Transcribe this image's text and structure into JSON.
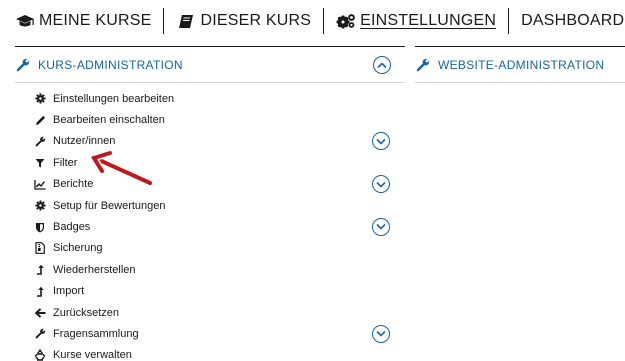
{
  "topnav": {
    "items": [
      {
        "label": "MEINE KURSE",
        "icon": "graduation-cap-icon"
      },
      {
        "label": "DIESER KURS",
        "icon": "book-icon"
      },
      {
        "label": "EINSTELLUNGEN",
        "icon": "cogs-icon",
        "active": true
      },
      {
        "label": "DASHBOARD"
      }
    ]
  },
  "course_admin": {
    "title": "KURS-ADMINISTRATION",
    "items": [
      {
        "label": "Einstellungen bearbeiten",
        "icon": "gear-icon"
      },
      {
        "label": "Bearbeiten einschalten",
        "icon": "pencil-icon"
      },
      {
        "label": "Nutzer/innen",
        "icon": "wrench-icon",
        "expandable": true
      },
      {
        "label": "Filter",
        "icon": "filter-icon"
      },
      {
        "label": "Berichte",
        "icon": "line-chart-icon",
        "expandable": true
      },
      {
        "label": "Setup für Bewertungen",
        "icon": "gear-icon"
      },
      {
        "label": "Badges",
        "icon": "shield-icon",
        "expandable": true
      },
      {
        "label": "Sicherung",
        "icon": "file-archive-icon"
      },
      {
        "label": "Wiederherstellen",
        "icon": "level-up-icon"
      },
      {
        "label": "Import",
        "icon": "level-up-icon"
      },
      {
        "label": "Zurücksetzen",
        "icon": "arrow-left-icon"
      },
      {
        "label": "Fragensammlung",
        "icon": "wrench-icon",
        "expandable": true
      },
      {
        "label": "Kurse verwalten",
        "icon": "recycle-icon"
      }
    ]
  },
  "site_admin": {
    "title": "WEBSITE-ADMINISTRATION"
  },
  "colors": {
    "link": "#1565a6",
    "text": "#1a1a1a",
    "annotation_arrow": "#c0181f"
  }
}
